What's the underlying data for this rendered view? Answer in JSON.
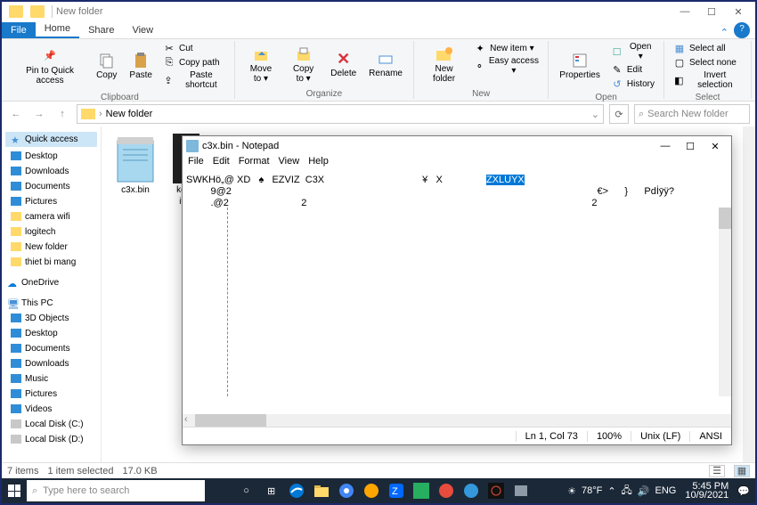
{
  "window": {
    "title": "New folder"
  },
  "tabs": {
    "file": "File",
    "home": "Home",
    "share": "Share",
    "view": "View"
  },
  "ribbon": {
    "clipboard": {
      "label": "Clipboard",
      "pin": "Pin to Quick\naccess",
      "copy": "Copy",
      "paste": "Paste",
      "cut": "Cut",
      "copypath": "Copy path",
      "pasteshortcut": "Paste shortcut"
    },
    "organize": {
      "label": "Organize",
      "moveto": "Move\nto ▾",
      "copyto": "Copy\nto ▾",
      "delete": "Delete",
      "rename": "Rename"
    },
    "new": {
      "label": "New",
      "newfolder": "New\nfolder",
      "newitem": "New item ▾",
      "easyaccess": "Easy access ▾"
    },
    "open": {
      "label": "Open",
      "properties": "Properties",
      "open": "Open ▾",
      "edit": "Edit",
      "history": "History"
    },
    "select": {
      "label": "Select",
      "all": "Select all",
      "none": "Select none",
      "invert": "Invert selection"
    }
  },
  "address": {
    "path": "New folder"
  },
  "search": {
    "placeholder": "Search New folder"
  },
  "sidebar": {
    "quickaccess": "Quick access",
    "qa_items": [
      {
        "label": "Desktop",
        "color": "#2f8dd8"
      },
      {
        "label": "Downloads",
        "color": "#2f8dd8"
      },
      {
        "label": "Documents",
        "color": "#2f8dd8"
      },
      {
        "label": "Pictures",
        "color": "#2f8dd8"
      },
      {
        "label": "camera wifi",
        "color": "#ffd96a"
      },
      {
        "label": "logitech",
        "color": "#ffd96a"
      },
      {
        "label": "New folder",
        "color": "#ffd96a"
      },
      {
        "label": "thiet bi mang",
        "color": "#ffd96a"
      }
    ],
    "onedrive": "OneDrive",
    "thispc": "This PC",
    "pc_items": [
      {
        "label": "3D Objects",
        "color": "#2f8dd8"
      },
      {
        "label": "Desktop",
        "color": "#2f8dd8"
      },
      {
        "label": "Documents",
        "color": "#2f8dd8"
      },
      {
        "label": "Downloads",
        "color": "#2f8dd8"
      },
      {
        "label": "Music",
        "color": "#2f8dd8"
      },
      {
        "label": "Pictures",
        "color": "#2f8dd8"
      },
      {
        "label": "Videos",
        "color": "#2f8dd8"
      },
      {
        "label": "Local Disk (C:)",
        "color": "#c8c8c8"
      },
      {
        "label": "Local Disk (D:)",
        "color": "#c8c8c8"
      }
    ]
  },
  "files": {
    "item1": "c3x.bin",
    "item2_a": "ket n",
    "item2_b": "ivm"
  },
  "status": {
    "items": "7 items",
    "selected": "1 item selected",
    "size": "17.0 KB"
  },
  "notepad": {
    "title": "c3x.bin - Notepad",
    "menu": {
      "file": "File",
      "edit": "Edit",
      "format": "Format",
      "view": "View",
      "help": "Help"
    },
    "line1_a": "SWKHö„@ XD   ",
    "line1_b": "♠   EZVIZ  C3X",
    "line1_c": "¥   X   ",
    "sel": "ZXLUYX",
    "line2_a": "         9@2       ",
    "line2_b": "   €>      }      Pdİȳÿ?",
    "line3_a": "         .@2       ",
    "line3_b": "2",
    "line3_c": "2",
    "status": {
      "pos": "Ln 1, Col 73",
      "zoom": "100%",
      "eol": "Unix (LF)",
      "enc": "ANSI"
    }
  },
  "taskbar": {
    "search": "Type here to search",
    "weather": "78°F",
    "lang": "ENG",
    "time": "5:45 PM",
    "date": "10/9/2021"
  }
}
